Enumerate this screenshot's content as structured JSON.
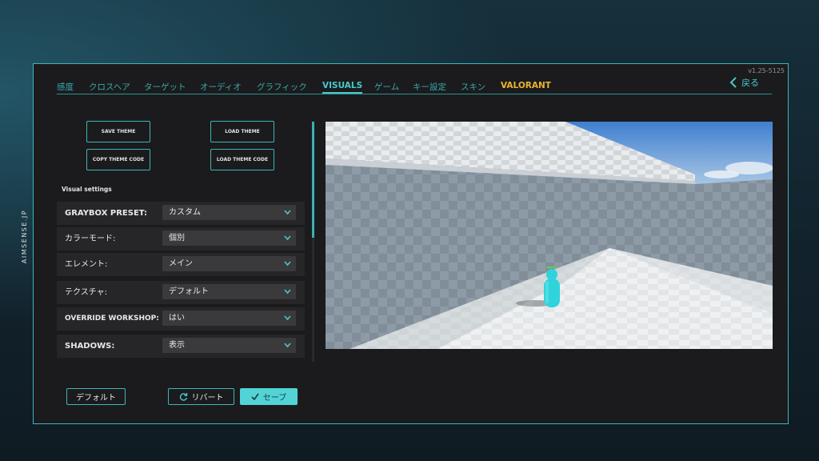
{
  "brand": "AIMSENSE.JP",
  "version": "v1.25-5125",
  "tabs": [
    {
      "label": "感度",
      "active": false
    },
    {
      "label": "クロスヘア",
      "active": false
    },
    {
      "label": "ターゲット",
      "active": false
    },
    {
      "label": "オーディオ",
      "active": false
    },
    {
      "label": "グラフィック",
      "active": false
    },
    {
      "label": "VISUALS",
      "active": true
    },
    {
      "label": "ゲーム",
      "active": false
    },
    {
      "label": "キー設定",
      "active": false
    },
    {
      "label": "スキン",
      "active": false
    },
    {
      "label": "VALORANT",
      "active": false
    }
  ],
  "back_label": "戻る",
  "theme_buttons": {
    "save": "SAVE THEME",
    "load": "LOAD THEME",
    "copy_code": "COPY THEME CODE",
    "load_code": "LOAD THEME CODE"
  },
  "section_title": "Visual settings",
  "settings": [
    {
      "label": "GRAYBOX PRESET:",
      "value": "カスタム"
    },
    {
      "label": "カラーモード:",
      "value": "個別"
    },
    {
      "label": "エレメント:",
      "value": "メイン"
    },
    {
      "label": "テクスチャ:",
      "value": "デフォルト"
    },
    {
      "label": "OVERRIDE WORKSHOP:",
      "value": "はい"
    },
    {
      "label": "SHADOWS:",
      "value": "表示"
    }
  ],
  "footer": {
    "default_label": "デフォルト",
    "revert_label": "リバート",
    "save_label": "セーブ"
  },
  "colors": {
    "accent": "#3db5b8",
    "valorant_tab": "#e8b530",
    "target": "#2fd3dc"
  }
}
